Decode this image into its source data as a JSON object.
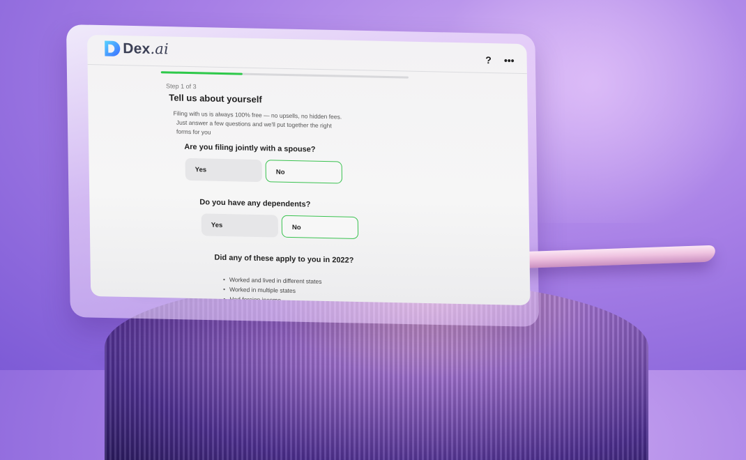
{
  "app": {
    "logo_text": "Dex",
    "logo_suffix": ".ai",
    "help_label": "?",
    "menu_label": "•••"
  },
  "progress": {
    "current_step": 1,
    "total_steps": 3,
    "fraction": 0.33
  },
  "step_label": "Step 1 of 3",
  "title": "Tell us about yourself",
  "intro_line1": "Filing with us is always 100% free — no upsells, no hidden fees.",
  "intro_line2": "Just answer a few questions and we'll put together the right",
  "intro_line3": "forms for you",
  "questions": [
    {
      "text": "Are you filing jointly with a spouse?",
      "yes_label": "Yes",
      "no_label": "No",
      "selected": "No"
    },
    {
      "text": "Do you have any dependents?",
      "yes_label": "Yes",
      "no_label": "No",
      "selected": "No"
    },
    {
      "text": "Did any of these apply to you in 2022?"
    }
  ],
  "checklist": [
    "Worked and lived in different states",
    "Worked in multiple states",
    "Had foreign income"
  ],
  "colors": {
    "accent_green": "#2ec94a",
    "background_purple": "#a77fe6"
  }
}
